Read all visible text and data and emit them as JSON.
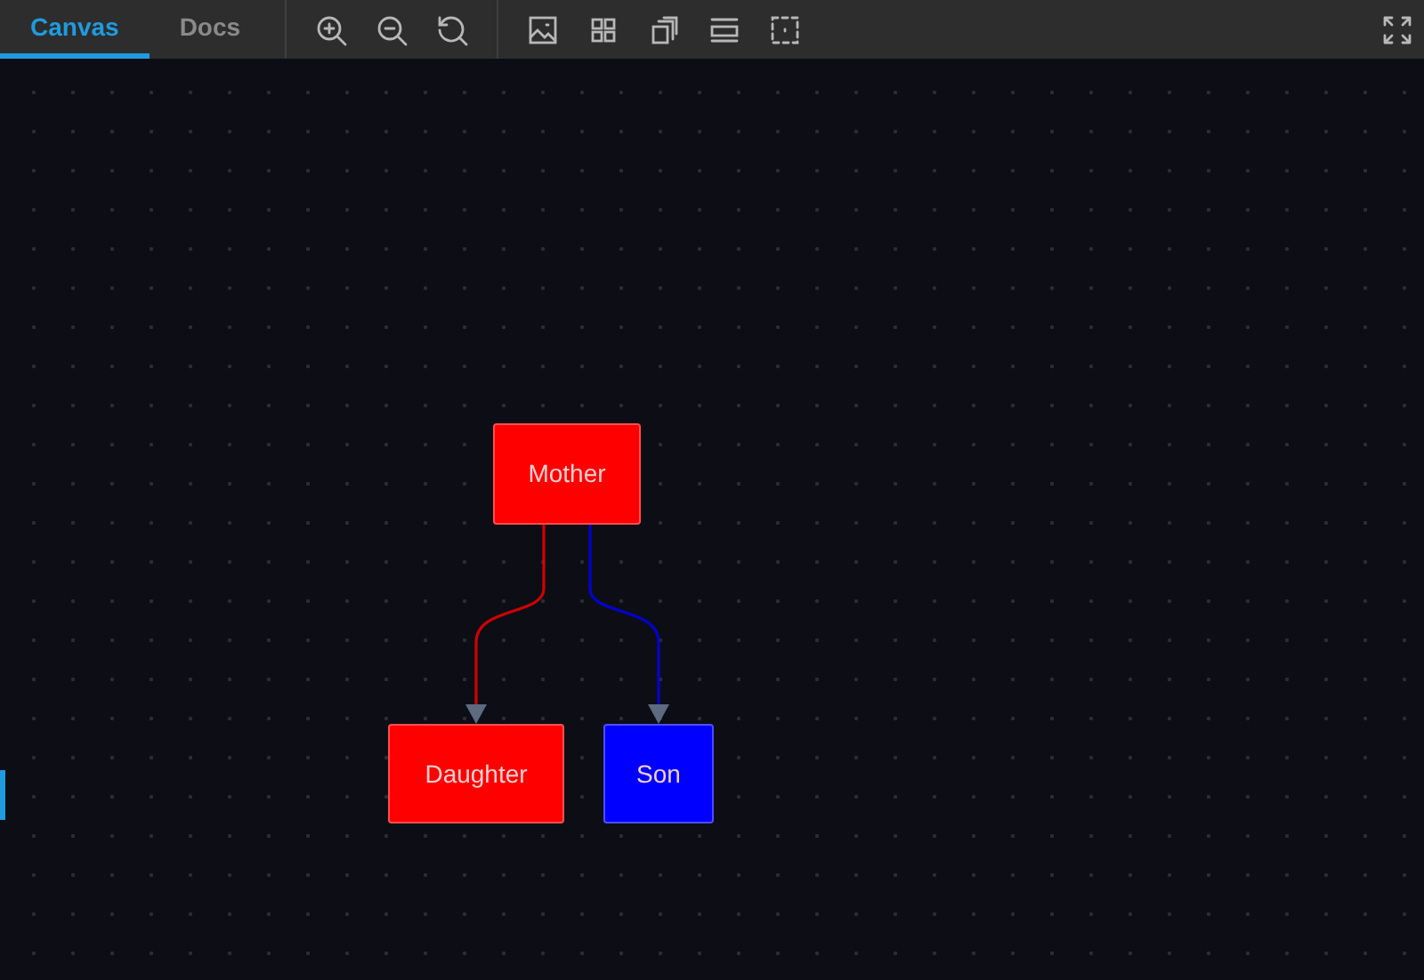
{
  "tabs": [
    {
      "label": "Canvas",
      "selected": true
    },
    {
      "label": "Docs",
      "selected": false
    }
  ],
  "root": {
    "label": "Mother",
    "color": "#ff0000",
    "children": [
      {
        "label": "Daughter",
        "color": "#ff0000"
      },
      {
        "label": "Son",
        "color": "#0000ff"
      }
    ]
  }
}
